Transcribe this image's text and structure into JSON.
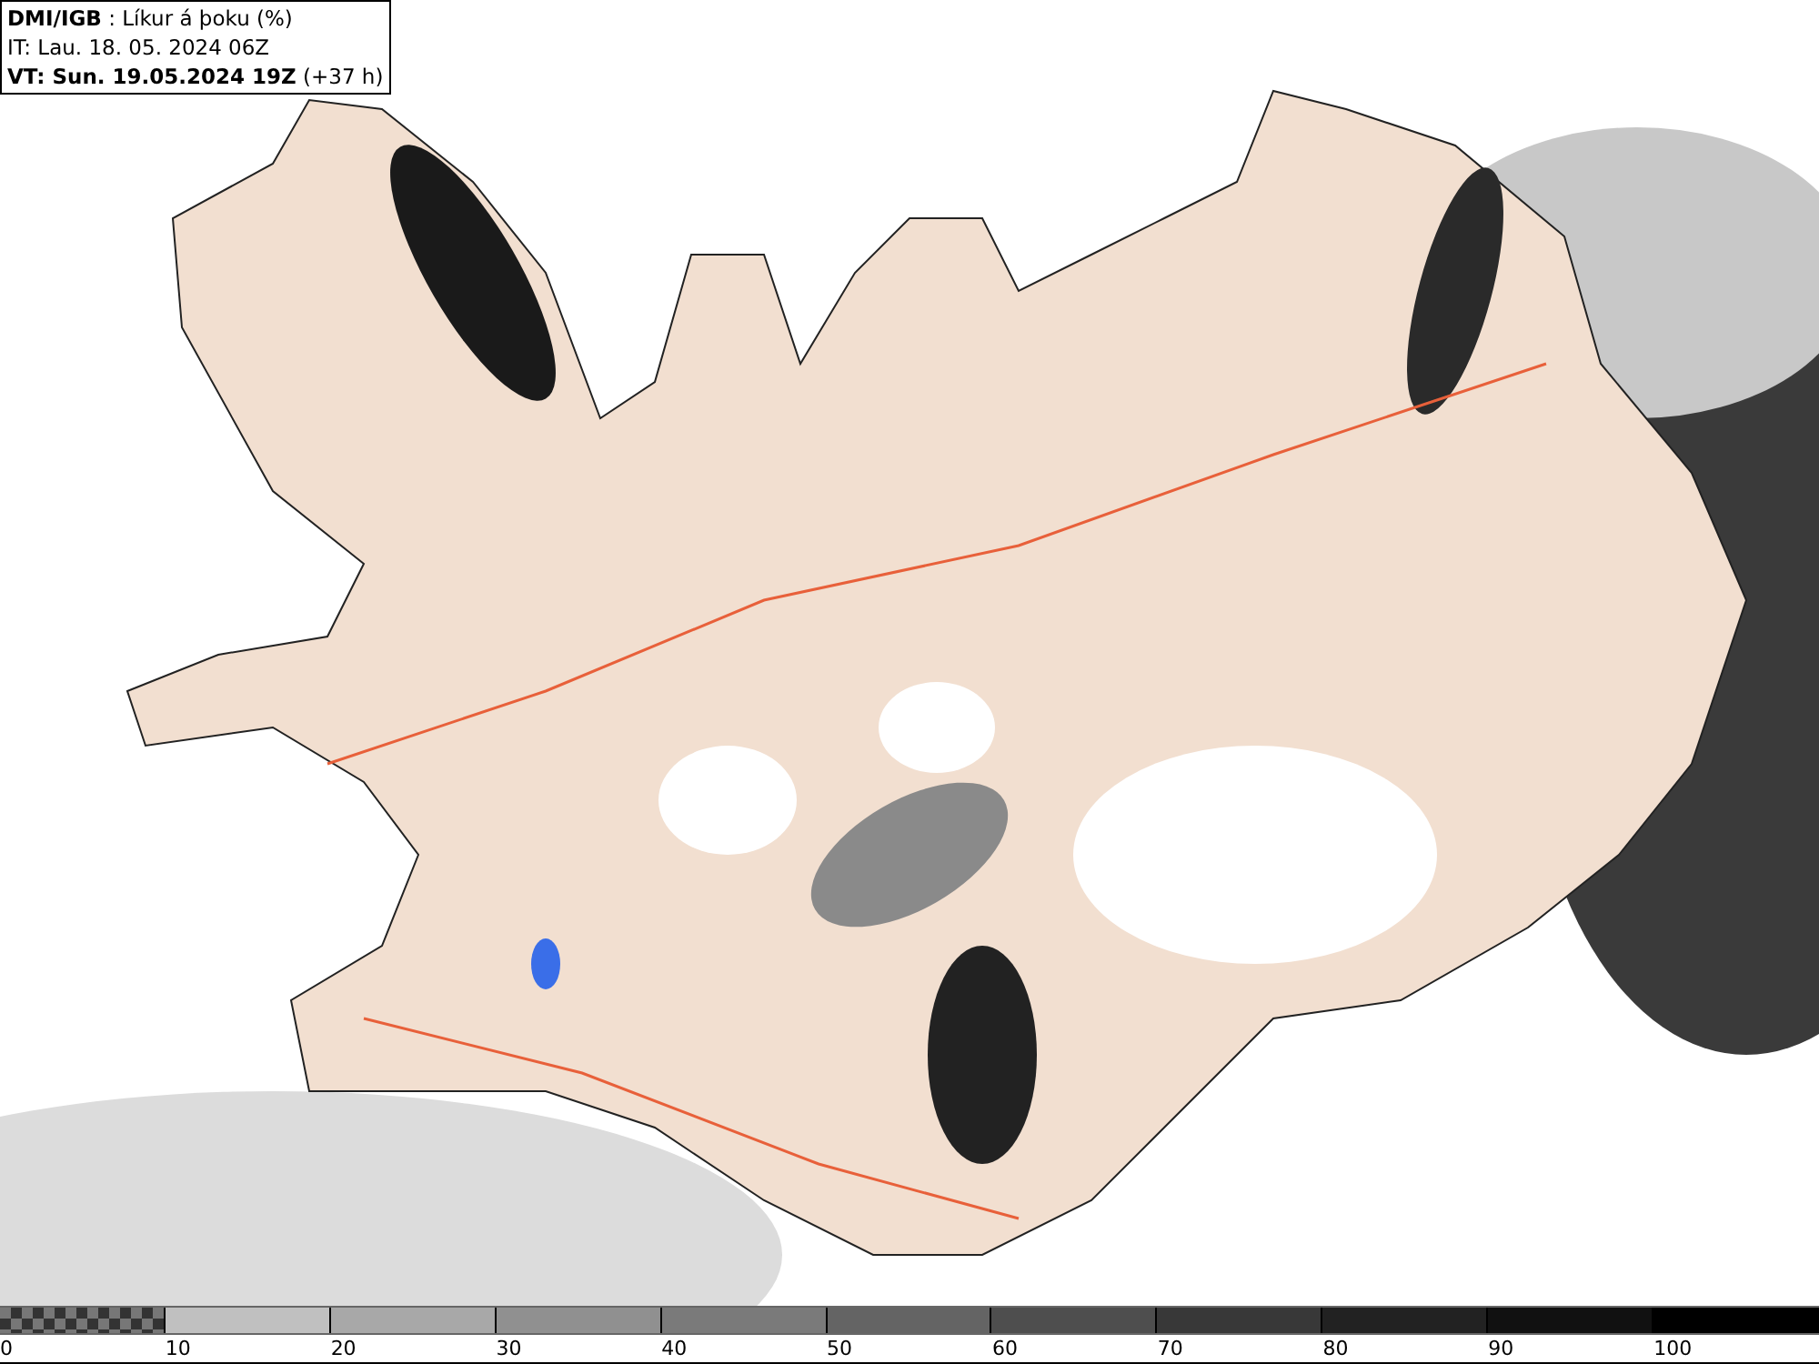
{
  "header": {
    "lines": [
      "**DMI/IGB** : Líkur á þoku (%)",
      "IT: Lau. 18. 05. 2024 06Z",
      "**VT: Sun. 19.05.2024 19Z** (+37 h)"
    ]
  },
  "legend": {
    "segments": [
      {
        "kind": "checker"
      },
      {
        "kind": "solid",
        "color": "#c0c0c0"
      },
      {
        "kind": "solid",
        "color": "#a8a8a8"
      },
      {
        "kind": "solid",
        "color": "#909090"
      },
      {
        "kind": "solid",
        "color": "#7a7a7a"
      },
      {
        "kind": "solid",
        "color": "#646464"
      },
      {
        "kind": "solid",
        "color": "#4e4e4e"
      },
      {
        "kind": "solid",
        "color": "#383838"
      },
      {
        "kind": "solid",
        "color": "#222222"
      },
      {
        "kind": "solid",
        "color": "#111111"
      },
      {
        "kind": "solid",
        "color": "#000000"
      }
    ],
    "ticks": [
      "0",
      "10",
      "20",
      "30",
      "40",
      "50",
      "60",
      "70",
      "80",
      "90",
      "100"
    ]
  }
}
